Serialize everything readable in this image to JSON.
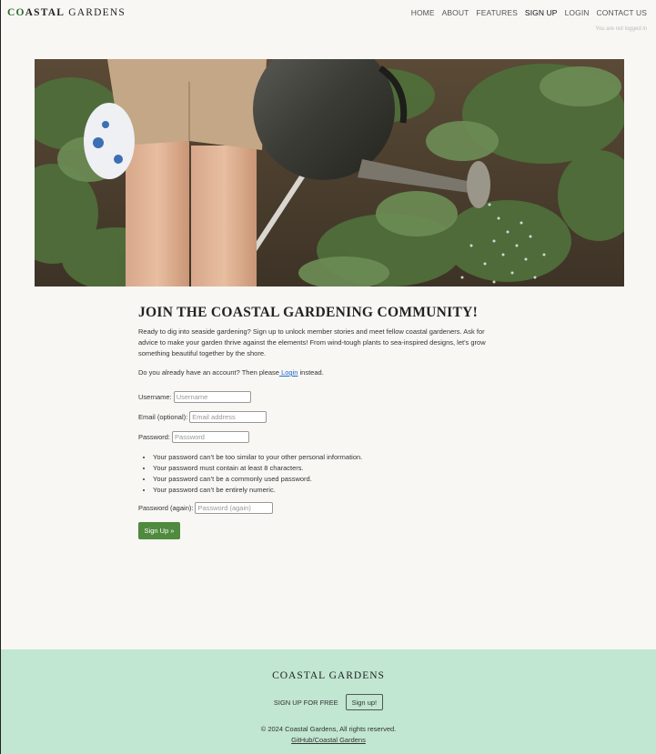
{
  "nav": {
    "brand": {
      "part1": "CO",
      "part2": "ASTAL",
      "part3": " GARDENS"
    },
    "items": [
      {
        "label": "HOME",
        "active": false
      },
      {
        "label": "ABOUT",
        "active": false
      },
      {
        "label": "FEATURES",
        "active": false
      },
      {
        "label": "SIGN UP",
        "active": true
      },
      {
        "label": "LOGIN",
        "active": false
      },
      {
        "label": "CONTACT US",
        "active": false
      }
    ],
    "status": "You are not logged in"
  },
  "main": {
    "title": "JOIN THE COASTAL GARDENING COMMUNITY!",
    "intro": "Ready to dig into seaside gardening? Sign up to unlock member stories and meet fellow coastal gardeners. Ask for advice to make your garden thrive against the elements! From wind-tough plants to sea-inspired designs, let's grow something beautiful together by the shore.",
    "already_prefix": "Do you already have an account? Then please",
    "login_link": " Login",
    "already_suffix": " instead.",
    "fields": {
      "username": {
        "label": "Username:",
        "placeholder": "Username"
      },
      "email": {
        "label": "Email (optional):",
        "placeholder": "Email address"
      },
      "password": {
        "label": "Password:",
        "placeholder": "Password"
      },
      "password2": {
        "label": "Password (again):",
        "placeholder": "Password (again)"
      }
    },
    "rules": [
      "Your password can’t be too similar to your other personal information.",
      "Your password must contain at least 8 characters.",
      "Your password can’t be a commonly used password.",
      "Your password can’t be entirely numeric."
    ],
    "submit": "Sign Up »"
  },
  "footer": {
    "brand": "COASTAL GARDENS",
    "cta_text": "SIGN UP FOR FREE",
    "cta_button": "Sign up!",
    "copyright": "© 2024 Coastal Gardens, All rights reserved.",
    "github": "GitHub/Coastal Gardens"
  },
  "colors": {
    "accent": "#4f8a3e",
    "footer_bg": "#c1e6d1",
    "page_bg": "#f8f7f4",
    "link": "#2266cc"
  }
}
